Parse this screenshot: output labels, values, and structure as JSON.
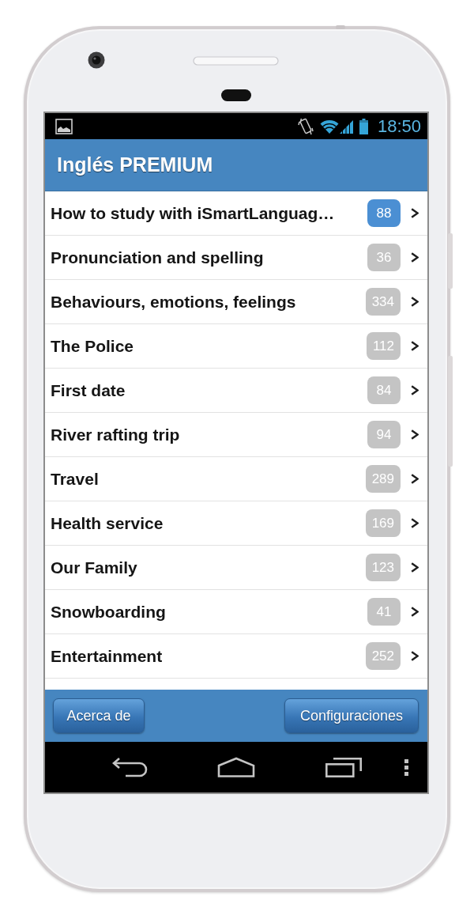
{
  "status_bar": {
    "time": "18:50"
  },
  "app_bar": {
    "title": "Inglés PREMIUM"
  },
  "lessons": [
    {
      "title": "How to study with iSmartLanguag…",
      "count": "88",
      "color": "#4b8fd3"
    },
    {
      "title": "Pronunciation and spelling",
      "count": "36",
      "color": "#c4c4c4"
    },
    {
      "title": "Behaviours, emotions, feelings",
      "count": "334",
      "color": "#c4c4c4"
    },
    {
      "title": "The Police",
      "count": "112",
      "color": "#c4c4c4"
    },
    {
      "title": "First date",
      "count": "84",
      "color": "#c4c4c4"
    },
    {
      "title": "River rafting trip",
      "count": "94",
      "color": "#c4c4c4"
    },
    {
      "title": "Travel",
      "count": "289",
      "color": "#c4c4c4"
    },
    {
      "title": "Health service",
      "count": "169",
      "color": "#c4c4c4"
    },
    {
      "title": "Our Family",
      "count": "123",
      "color": "#c4c4c4"
    },
    {
      "title": "Snowboarding",
      "count": "41",
      "color": "#c4c4c4"
    },
    {
      "title": "Entertainment",
      "count": "252",
      "color": "#c4c4c4"
    }
  ],
  "footer": {
    "left_button": "Acerca de",
    "right_button": "Configuraciones"
  }
}
